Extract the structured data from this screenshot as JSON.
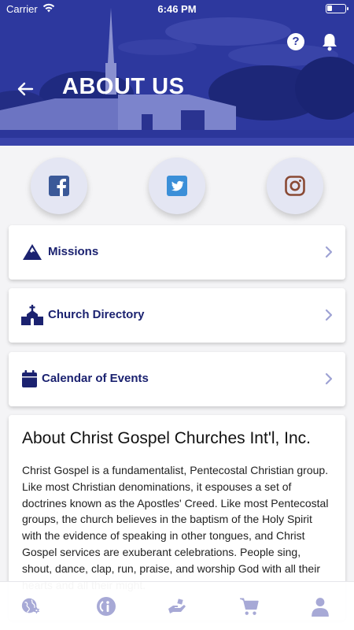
{
  "status_bar": {
    "carrier": "Carrier",
    "time": "6:46 PM",
    "battery_level": 0.3
  },
  "header": {
    "title": "ABOUT US",
    "help_label": "?"
  },
  "social": [
    {
      "name": "facebook",
      "icon": "facebook-icon",
      "color": "#3b5998"
    },
    {
      "name": "twitter",
      "icon": "twitter-icon",
      "color": "#3b8fd8"
    },
    {
      "name": "instagram",
      "icon": "instagram-icon",
      "color": "#8a4a35"
    }
  ],
  "menu": {
    "missions": "Missions",
    "church_directory": "Church Directory",
    "calendar": "Calendar of Events"
  },
  "about": {
    "title": "About Christ Gospel Churches Int'l, Inc.",
    "body": "Christ Gospel is a fundamentalist, Pentecostal Christian group. Like most Christian denominations, it espouses a set of doctrines known as the Apostles' Creed. Like most Pentecostal groups, the church believes in the baptism of the Holy Spirit with the evidence of speaking in other tongues, and Christ Gospel services are exuberant celebrations. People sing, shout, dance, clap, run, praise, and worship God with all their hearts and all their might."
  },
  "bottom_nav": [
    "globe-icon",
    "info-icon",
    "giving-icon",
    "cart-icon",
    "profile-icon"
  ],
  "colors": {
    "brand_blue": "#2f3aa0",
    "navy_text": "#1b2270",
    "nav_icon": "#a7a9d6"
  }
}
